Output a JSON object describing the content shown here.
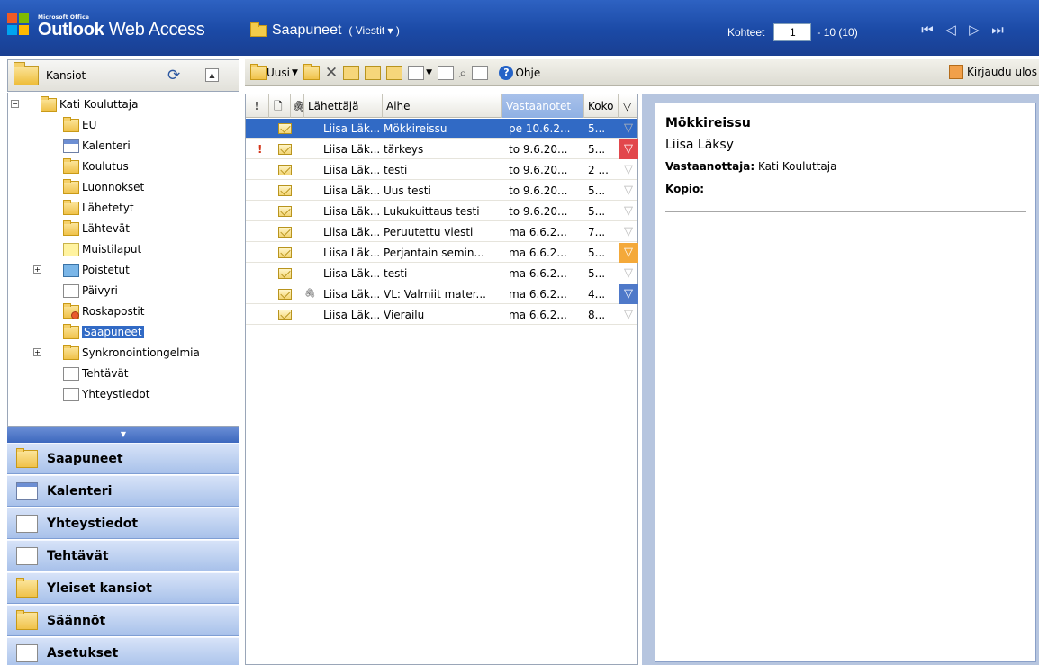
{
  "app": {
    "brand_small": "Microsoft Office",
    "brand_main": "Outlook",
    "brand_rest": " Web Access",
    "current_folder": "Saapuneet",
    "view_selector": "( Viestit ▾ )",
    "items_label": "Kohteet",
    "page_value": "1",
    "page_range": "- 10 (10)"
  },
  "folders_panel": {
    "title": "Kansiot",
    "user": "Kati Kouluttaja",
    "items": [
      {
        "label": "EU",
        "icon": "folder-icon"
      },
      {
        "label": "Kalenteri",
        "icon": "calendar-icon"
      },
      {
        "label": "Koulutus",
        "icon": "folder-icon"
      },
      {
        "label": "Luonnokset",
        "icon": "drafts-icon"
      },
      {
        "label": "Lähetetyt",
        "icon": "sent-icon"
      },
      {
        "label": "Lähtevät",
        "icon": "outbox-icon"
      },
      {
        "label": "Muistilaput",
        "icon": "notes-icon"
      },
      {
        "label": "Poistetut",
        "icon": "trash-icon"
      },
      {
        "label": "Päivyri",
        "icon": "journal-icon"
      },
      {
        "label": "Roskapostit",
        "icon": "junk-icon"
      },
      {
        "label": "Saapuneet",
        "icon": "inbox-icon"
      },
      {
        "label": "Synkronointiongelmia",
        "icon": "folder-icon"
      },
      {
        "label": "Tehtävät",
        "icon": "tasks-icon"
      },
      {
        "label": "Yhteystiedot",
        "icon": "contacts-icon"
      }
    ]
  },
  "nav": {
    "separator": ".... ▼ ....",
    "buttons": [
      {
        "label": "Saapuneet",
        "icon": "inbox-icon"
      },
      {
        "label": "Kalenteri",
        "icon": "calendar-icon"
      },
      {
        "label": "Yhteystiedot",
        "icon": "contacts-icon"
      },
      {
        "label": "Tehtävät",
        "icon": "tasks-icon"
      },
      {
        "label": "Yleiset kansiot",
        "icon": "public-folders-icon"
      },
      {
        "label": "Säännöt",
        "icon": "rules-icon"
      },
      {
        "label": "Asetukset",
        "icon": "options-icon"
      }
    ]
  },
  "toolbar": {
    "new_label": "Uusi",
    "help_label": "Ohje",
    "logout_label": "Kirjaudu ulos"
  },
  "list": {
    "headers": {
      "importance": "!",
      "type": "🗋",
      "attachment": "🖇",
      "sender": "Lähettäjä",
      "subject": "Aihe",
      "received": "Vastaanotet",
      "size": "Koko",
      "flag": "▽"
    },
    "rows": [
      {
        "importance": "",
        "attachment": "",
        "sender": "Liisa Läk...",
        "subject": "Mökkireissu",
        "received": "pe 10.6.2...",
        "size": "5...",
        "flag": "none"
      },
      {
        "importance": "!",
        "attachment": "",
        "sender": "Liisa Läk...",
        "subject": "tärkeys",
        "received": "to 9.6.20...",
        "size": "5...",
        "flag": "red"
      },
      {
        "importance": "",
        "attachment": "",
        "sender": "Liisa Läk...",
        "subject": "testi",
        "received": "to 9.6.20...",
        "size": "2 ...",
        "flag": "none"
      },
      {
        "importance": "",
        "attachment": "",
        "sender": "Liisa Läk...",
        "subject": "Uus testi",
        "received": "to 9.6.20...",
        "size": "5...",
        "flag": "none"
      },
      {
        "importance": "",
        "attachment": "",
        "sender": "Liisa Läk...",
        "subject": "Lukukuittaus testi",
        "received": "to 9.6.20...",
        "size": "5...",
        "flag": "none"
      },
      {
        "importance": "",
        "attachment": "",
        "sender": "Liisa Läk...",
        "subject": "Peruutettu viesti",
        "received": "ma 6.6.2...",
        "size": "7...",
        "flag": "none"
      },
      {
        "importance": "",
        "attachment": "",
        "sender": "Liisa Läk...",
        "subject": "Perjantain semin...",
        "received": "ma 6.6.2...",
        "size": "5...",
        "flag": "orange"
      },
      {
        "importance": "",
        "attachment": "",
        "sender": "Liisa Läk...",
        "subject": "testi",
        "received": "ma 6.6.2...",
        "size": "5...",
        "flag": "none"
      },
      {
        "importance": "",
        "attachment": "🖇",
        "sender": "Liisa Läk...",
        "subject": "VL: Valmiit mater...",
        "received": "ma 6.6.2...",
        "size": "4...",
        "flag": "blue"
      },
      {
        "importance": "",
        "attachment": "",
        "sender": "Liisa Läk...",
        "subject": "Vierailu",
        "received": "ma 6.6.2...",
        "size": "8...",
        "flag": "none"
      }
    ]
  },
  "reading": {
    "subject": "Mökkireissu",
    "sender": "Liisa Läksy",
    "to_label": "Vastaanottaja:",
    "to_value": "Kati Kouluttaja",
    "cc_label": "Kopio:"
  },
  "colors": {
    "title_bar": "#1b4aa6",
    "selection": "#316ac5",
    "flag_red": "#e2474c",
    "flag_orange": "#f4a93a",
    "flag_blue": "#4f79c9"
  }
}
